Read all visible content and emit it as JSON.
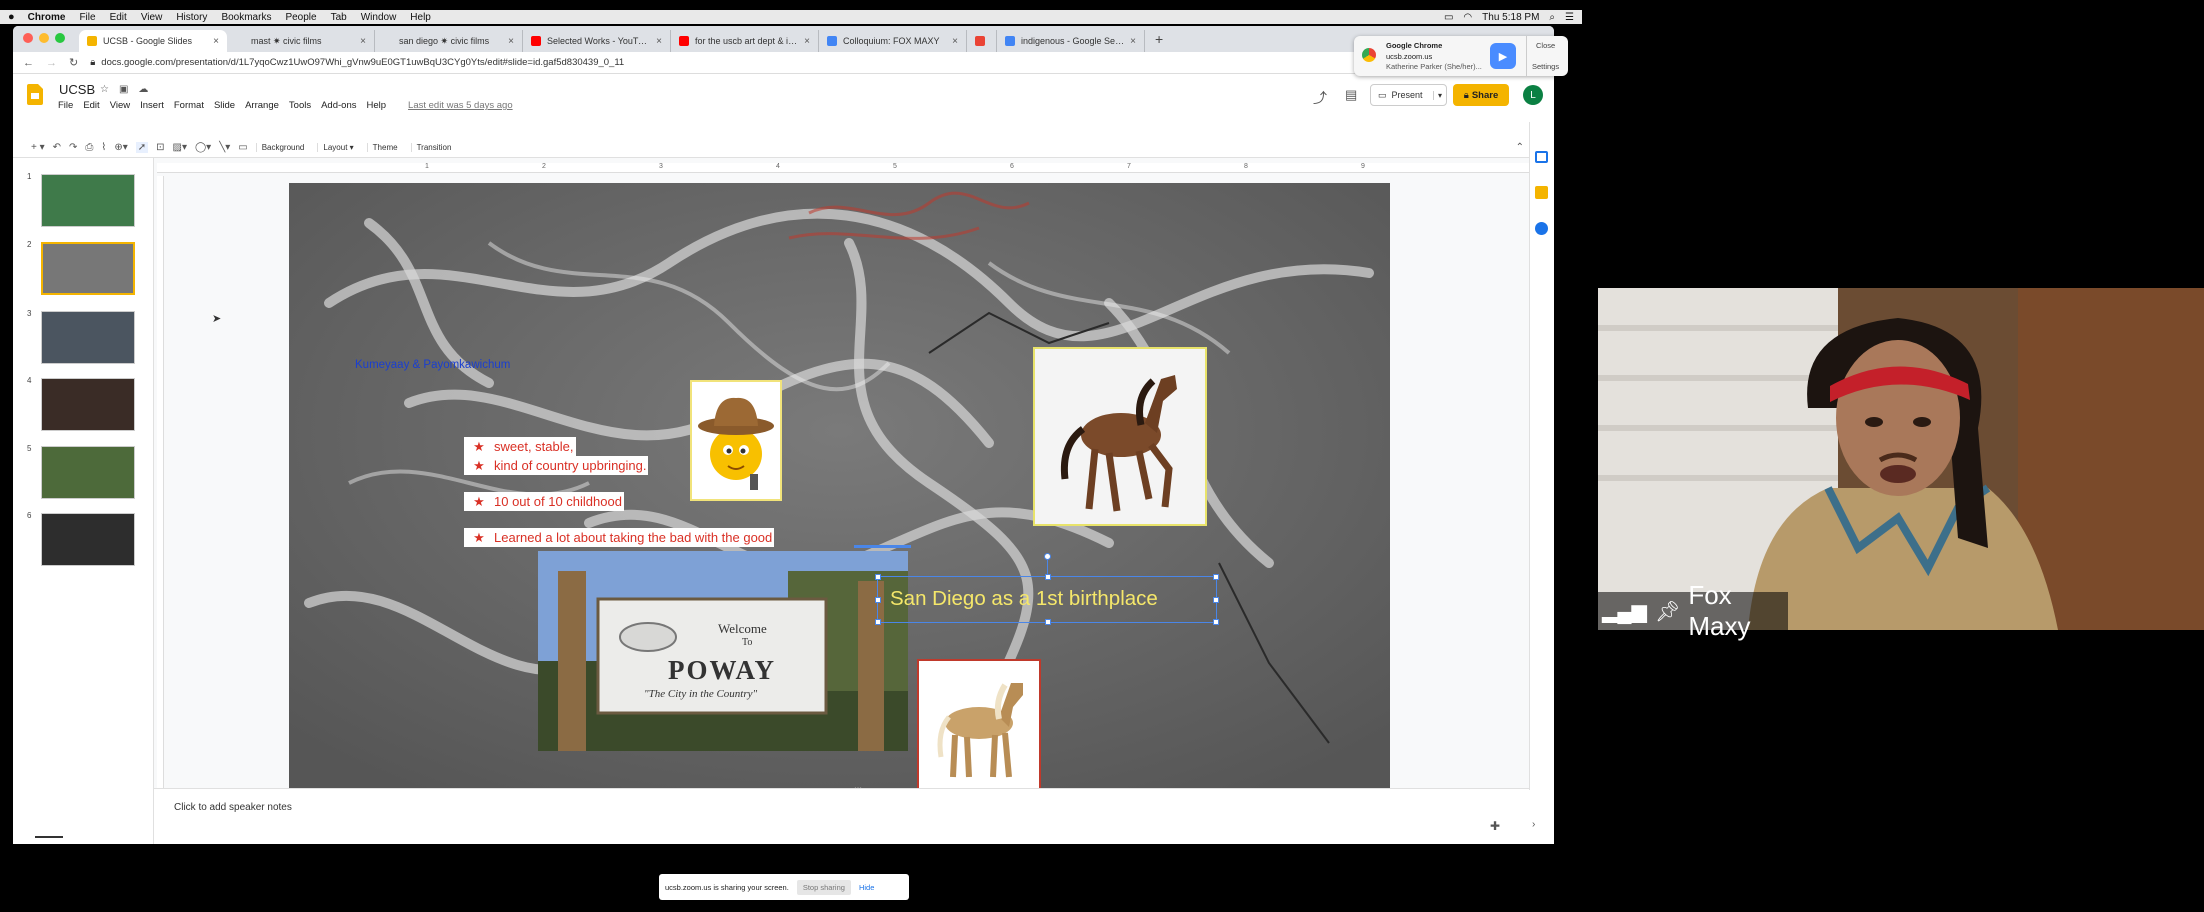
{
  "menubar": {
    "app": "Chrome",
    "items": [
      "File",
      "Edit",
      "View",
      "History",
      "Bookmarks",
      "People",
      "Tab",
      "Window",
      "Help"
    ],
    "clock": "Thu 5:18 PM"
  },
  "tabs": [
    {
      "label": "UCSB - Google Slides",
      "color": "#f4b400",
      "active": true
    },
    {
      "label": "mast ✷ civic films",
      "color": "#dee1e6",
      "active": false
    },
    {
      "label": "san diego ✷ civic films",
      "color": "#dee1e6",
      "active": false
    },
    {
      "label": "Selected Works - YouTube",
      "color": "#ff0000",
      "active": false
    },
    {
      "label": "for the uscb art dept & its arti",
      "color": "#ff0000",
      "active": false
    },
    {
      "label": "Colloquium: FOX MAXY",
      "color": "#4285f4",
      "active": false
    },
    {
      "label": "",
      "color": "#ea4335",
      "active": false
    },
    {
      "label": "indigenous - Google Search",
      "color": "#4285f4",
      "active": false
    }
  ],
  "address": {
    "url": "docs.google.com/presentation/d/1L7yqoCwz1UwO97Whi_gVnw9uE0GT1uwBqU3CYg0Yts/edit#slide=id.gaf5d830439_0_11"
  },
  "notification": {
    "app": "Google Chrome",
    "site": "ucsb.zoom.us",
    "person": "Katherine Parker (She/her)...",
    "close": "Close",
    "settings": "Settings"
  },
  "doc": {
    "title": "UCSB",
    "menus": [
      "File",
      "Edit",
      "View",
      "Insert",
      "Format",
      "Slide",
      "Arrange",
      "Tools",
      "Add-ons",
      "Help"
    ],
    "last_edit": "Last edit was 5 days ago",
    "present": "Present",
    "share": "Share",
    "avatar": "L"
  },
  "toolbar": {
    "background": "Background",
    "layout": "Layout ▾",
    "theme": "Theme",
    "transition": "Transition"
  },
  "ruler": [
    "1",
    "2",
    "3",
    "4",
    "5",
    "6",
    "7",
    "8",
    "9"
  ],
  "thumbnails": [
    {
      "num": "1",
      "color": "#3f7a4a"
    },
    {
      "num": "2",
      "color": "#777777"
    },
    {
      "num": "3",
      "color": "#4b5560"
    },
    {
      "num": "4",
      "color": "#3a2c26"
    },
    {
      "num": "5",
      "color": "#4d6a3a"
    },
    {
      "num": "6",
      "color": "#2d2d2d"
    }
  ],
  "slide": {
    "caption": "Kumeyaay & Payomkawichum",
    "bullets": [
      "sweet, stable,",
      "kind of country upbringing.",
      "10 out of 10 childhood",
      "Learned a lot about taking the bad with the good"
    ],
    "selected_text": "San Diego as a 1st birthplace",
    "sign": {
      "line1": "Welcome",
      "line2": "To",
      "line3": "POWAY",
      "line4": "\"The City in the Country\""
    }
  },
  "notes": {
    "placeholder": "Click to add speaker notes"
  },
  "video": {
    "name": "Fox Maxy"
  },
  "share_banner": {
    "text": "ucsb.zoom.us is sharing your screen.",
    "stop": "Stop sharing",
    "hide": "Hide"
  }
}
